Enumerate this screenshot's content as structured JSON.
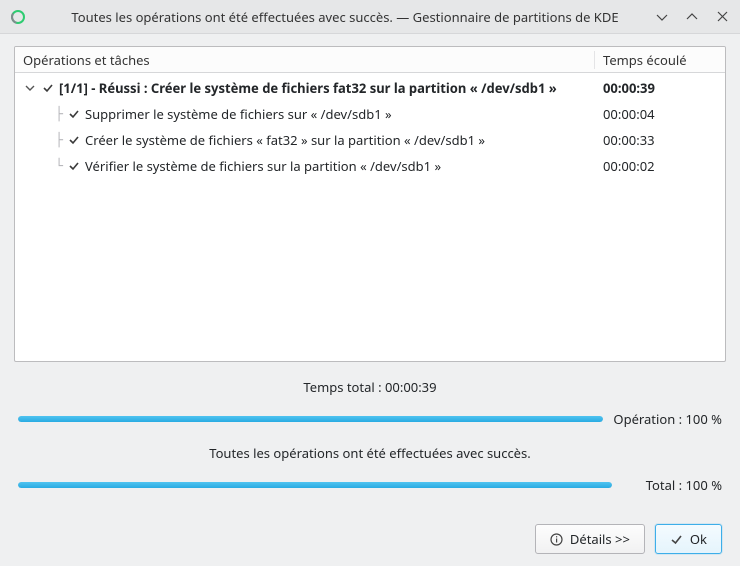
{
  "window": {
    "title": "Toutes les opérations ont été effectuées avec succès. — Gestionnaire de partitions de KDE"
  },
  "tree": {
    "header": {
      "operations": "Opérations et tâches",
      "elapsed": "Temps écoulé"
    },
    "root": {
      "label": "[1/1] - Réussi : Créer le système de fichiers fat32 sur la partition « /dev/sdb1 »",
      "time": "00:00:39"
    },
    "tasks": [
      {
        "label": "Supprimer le système de fichiers sur « /dev/sdb1 »",
        "time": "00:00:04"
      },
      {
        "label": "Créer le système de fichiers « fat32 » sur la partition « /dev/sdb1 »",
        "time": "00:00:33"
      },
      {
        "label": "Vérifier le système de fichiers sur la partition « /dev/sdb1 »",
        "time": "00:00:02"
      }
    ]
  },
  "status": {
    "total_time": "Temps total : 00:00:39",
    "message": "Toutes les opérations ont été effectuées avec succès.",
    "operation_label": "Opération : 100 %",
    "operation_percent": 100,
    "total_label": "Total : 100 %",
    "total_percent": 100
  },
  "buttons": {
    "details": "Détails >>",
    "ok": "Ok"
  }
}
